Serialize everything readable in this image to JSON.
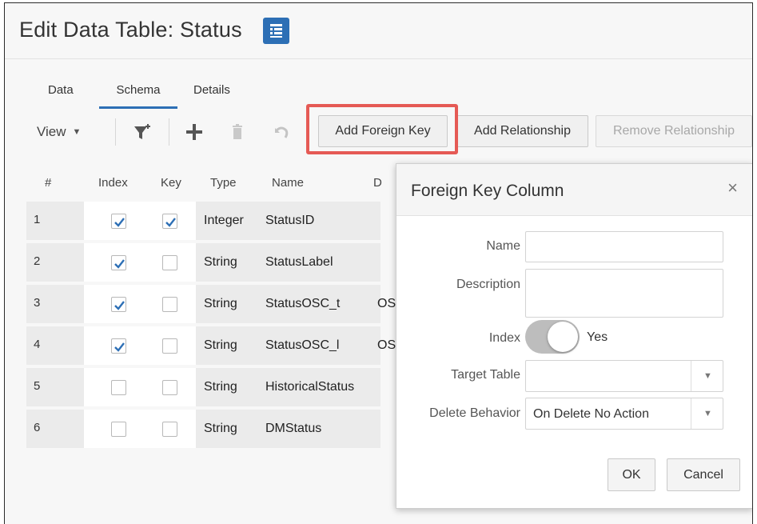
{
  "page": {
    "title": "Edit Data Table: Status"
  },
  "tabs": [
    {
      "label": "Data",
      "active": false
    },
    {
      "label": "Schema",
      "active": true
    },
    {
      "label": "Details",
      "active": false
    }
  ],
  "toolbar": {
    "view_label": "View",
    "add_foreign_key": "Add Foreign Key",
    "add_relationship": "Add Relationship",
    "remove_relationship": "Remove Relationship",
    "icons": [
      "filter-icon",
      "add-icon",
      "delete-icon",
      "undo-icon"
    ]
  },
  "grid": {
    "columns": [
      "#",
      "Index",
      "Key",
      "Type",
      "Name",
      "D"
    ],
    "rows": [
      {
        "num": "1",
        "index": true,
        "key": true,
        "type": "Integer",
        "name": "StatusID",
        "desc": ""
      },
      {
        "num": "2",
        "index": true,
        "key": false,
        "type": "String",
        "name": "StatusLabel",
        "desc": ""
      },
      {
        "num": "3",
        "index": true,
        "key": false,
        "type": "String",
        "name": "StatusOSC_t",
        "desc": "OS"
      },
      {
        "num": "4",
        "index": true,
        "key": false,
        "type": "String",
        "name": "StatusOSC_l",
        "desc": "OS"
      },
      {
        "num": "5",
        "index": false,
        "key": false,
        "type": "String",
        "name": "HistoricalStatus",
        "desc": ""
      },
      {
        "num": "6",
        "index": false,
        "key": false,
        "type": "String",
        "name": "DMStatus",
        "desc": ""
      }
    ]
  },
  "dialog": {
    "title": "Foreign Key Column",
    "close": "×",
    "name_label": "Name",
    "name_value": "",
    "description_label": "Description",
    "description_value": "",
    "index_label": "Index",
    "index_toggle_text": "Yes",
    "target_table_label": "Target Table",
    "target_table_value": "",
    "delete_behavior_label": "Delete Behavior",
    "delete_behavior_value": "On Delete No Action",
    "ok": "OK",
    "cancel": "Cancel"
  },
  "colors": {
    "accent": "#2d6fb5",
    "highlight": "#e55a55",
    "check": "#2d6fb5"
  }
}
